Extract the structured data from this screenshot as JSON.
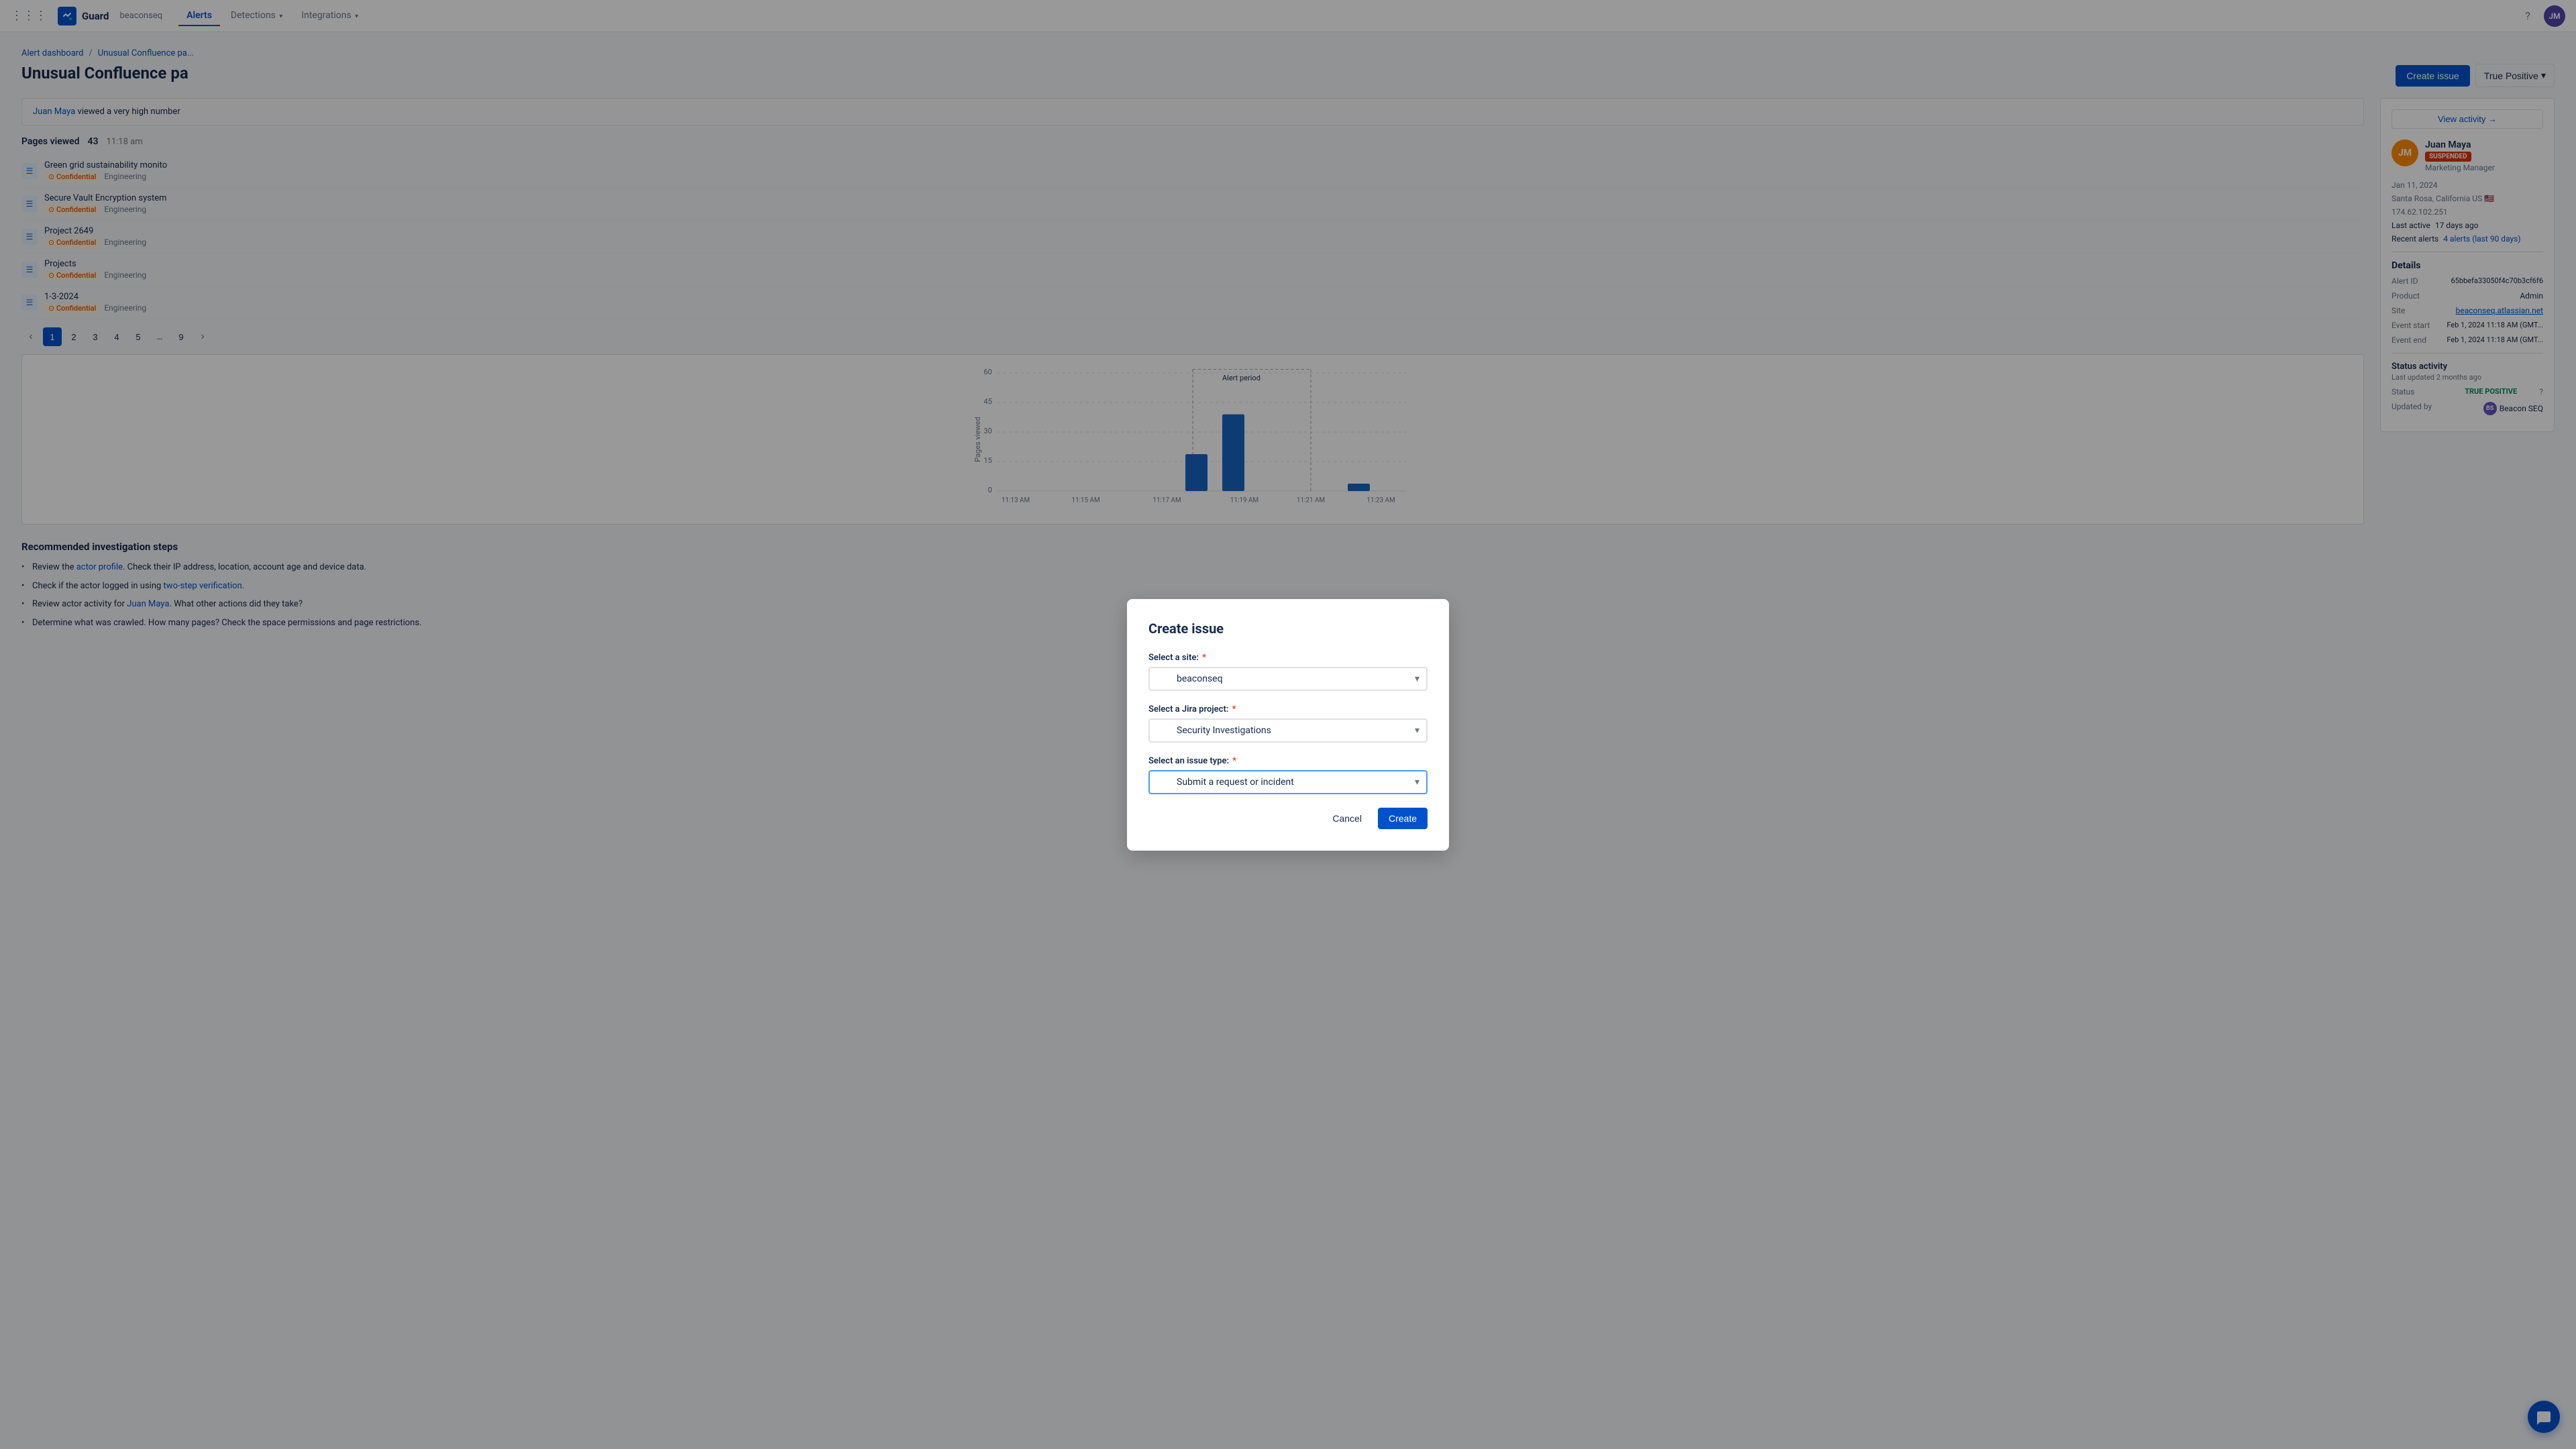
{
  "app": {
    "name": "Guard",
    "logo_text": "G"
  },
  "topnav": {
    "workspace": "beaconseq",
    "links": [
      {
        "id": "alerts",
        "label": "Alerts",
        "active": true
      },
      {
        "id": "detections",
        "label": "Detections",
        "has_chevron": true
      },
      {
        "id": "integrations",
        "label": "Integrations",
        "has_chevron": true
      }
    ],
    "help_icon": "?",
    "avatar_initials": "JM"
  },
  "breadcrumb": {
    "items": [
      {
        "label": "Alert dashboard",
        "link": true
      },
      {
        "label": "Unusual Confluence pa...",
        "link": true
      }
    ]
  },
  "page": {
    "title": "Unusual Confluence pa",
    "create_issue_label": "Create issue",
    "true_positive_label": "True Positive"
  },
  "alert_info": {
    "user_link": "Juan Maya",
    "text": "viewed a very high number"
  },
  "pages_section": {
    "title": "Pages viewed",
    "count": "43",
    "time": "11:18 am",
    "items": [
      {
        "name": "Green grid sustainability monito",
        "confidential": true,
        "tag": "Engineering"
      },
      {
        "name": "Secure Vault Encryption system",
        "confidential": true,
        "tag": "Engineering"
      },
      {
        "name": "Project 2649",
        "confidential": true,
        "tag": "Engineering"
      },
      {
        "name": "Projects",
        "confidential": true,
        "tag": "Engineering"
      },
      {
        "name": "1-3-2024",
        "confidential": true,
        "tag": "Engineering"
      }
    ],
    "pagination": {
      "pages": [
        "1",
        "2",
        "3",
        "4",
        "5",
        "...",
        "9"
      ]
    }
  },
  "chart": {
    "alert_period_label": "Alert period",
    "y_label": "Pages viewed",
    "y_ticks": [
      "60",
      "45",
      "30",
      "15",
      "0"
    ],
    "x_ticks": [
      "11:13 AM",
      "11:15 AM",
      "11:17 AM",
      "11:19 AM",
      "11:21 AM",
      "11:23 AM"
    ],
    "bars": [
      {
        "x_pct": 36,
        "height_pct": 28,
        "highlight": false
      },
      {
        "x_pct": 49,
        "height_pct": 62,
        "highlight": true
      },
      {
        "x_pct": 69,
        "height_pct": 5,
        "highlight": false
      }
    ]
  },
  "recommendations": {
    "title": "Recommended investigation steps",
    "items": [
      "Review the <a href='#'>actor profile</a>. Check their IP address, location, account age and device data.",
      "Check if the actor logged in using <a href='#'>two-step verification</a>.",
      "Review actor activity for <a href='#'>Juan Maya</a>. What other actions did they take?",
      "Determine what was crawled. How many pages? Check the space permissions and page restrictions."
    ]
  },
  "right_panel": {
    "view_activity_label": "View activity →",
    "user": {
      "name": "Juan Maya",
      "status": "SUSPENDED",
      "role": "Marketing Manager",
      "date": "Jan 11, 2024",
      "location": "Santa Rosa, California US 🇺🇸",
      "ip": "174.62.102.251",
      "last_active_label": "Last active",
      "last_active_value": "17 days ago",
      "recent_alerts_label": "Recent alerts",
      "recent_alerts_value": "4 alerts (last 90 days)"
    },
    "details": {
      "title": "Details",
      "rows": [
        {
          "label": "Alert ID",
          "value": "65bbefa33050f4c70b3cf6f6"
        },
        {
          "label": "Product",
          "value": "Admin"
        },
        {
          "label": "Site",
          "value": "beaconseq.atlassian.net",
          "link": true
        },
        {
          "label": "Event start",
          "value": "Feb 1, 2024 11:18 AM (GMT..."
        },
        {
          "label": "Event end",
          "value": "Feb 1, 2024 11:18 AM (GMT..."
        }
      ]
    },
    "status_activity": {
      "title": "Status activity",
      "last_updated": "Last updated 2 months ago",
      "status_label": "Status",
      "status_value": "TRUE POSITIVE",
      "updated_by_label": "Updated by",
      "updated_by_name": "Beacon SEQ",
      "updated_by_initials": "BS"
    }
  },
  "modal": {
    "title": "Create issue",
    "site_label": "Select a site:",
    "site_required": true,
    "site_value": "beaconseq",
    "project_label": "Select a Jira project:",
    "project_required": true,
    "project_value": "Security Investigations",
    "issue_type_label": "Select an issue type:",
    "issue_type_required": true,
    "issue_type_value": "Submit a request or incident",
    "cancel_label": "Cancel",
    "create_label": "Create"
  },
  "chat_btn": "💬"
}
